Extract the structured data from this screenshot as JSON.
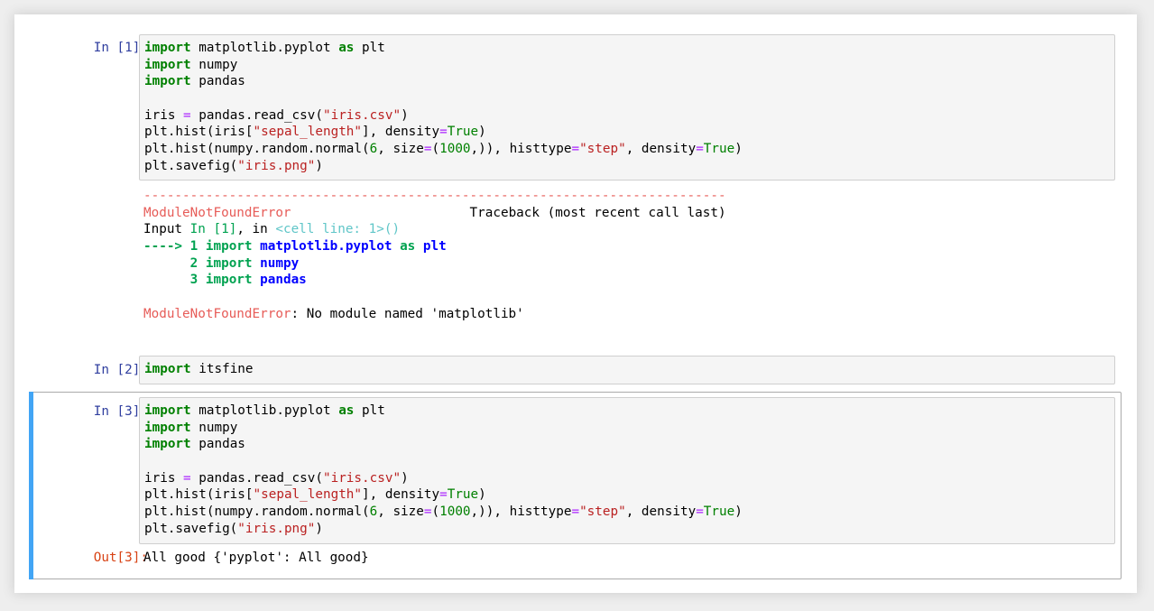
{
  "cell1": {
    "prompt": "In [1]:",
    "lines": [
      [
        {
          "t": "import",
          "c": "kw"
        },
        {
          "t": " matplotlib.pyplot ",
          "c": ""
        },
        {
          "t": "as",
          "c": "kw"
        },
        {
          "t": " plt",
          "c": ""
        }
      ],
      [
        {
          "t": "import",
          "c": "kw"
        },
        {
          "t": " numpy",
          "c": ""
        }
      ],
      [
        {
          "t": "import",
          "c": "kw"
        },
        {
          "t": " pandas",
          "c": ""
        }
      ],
      [],
      [
        {
          "t": "iris ",
          "c": ""
        },
        {
          "t": "=",
          "c": "op"
        },
        {
          "t": " pandas.read_csv(",
          "c": ""
        },
        {
          "t": "\"iris.csv\"",
          "c": "str"
        },
        {
          "t": ")",
          "c": ""
        }
      ],
      [
        {
          "t": "plt.hist(iris[",
          "c": ""
        },
        {
          "t": "\"sepal_length\"",
          "c": "str"
        },
        {
          "t": "], density",
          "c": ""
        },
        {
          "t": "=",
          "c": "op"
        },
        {
          "t": "True",
          "c": "kw-plain"
        },
        {
          "t": ")",
          "c": ""
        }
      ],
      [
        {
          "t": "plt.hist(numpy.random.normal(",
          "c": ""
        },
        {
          "t": "6",
          "c": "num"
        },
        {
          "t": ", size",
          "c": ""
        },
        {
          "t": "=",
          "c": "op"
        },
        {
          "t": "(",
          "c": ""
        },
        {
          "t": "1000",
          "c": "num"
        },
        {
          "t": ",)), histtype",
          "c": ""
        },
        {
          "t": "=",
          "c": "op"
        },
        {
          "t": "\"step\"",
          "c": "str"
        },
        {
          "t": ", density",
          "c": ""
        },
        {
          "t": "=",
          "c": "op"
        },
        {
          "t": "True",
          "c": "kw-plain"
        },
        {
          "t": ")",
          "c": ""
        }
      ],
      [
        {
          "t": "plt.savefig(",
          "c": ""
        },
        {
          "t": "\"iris.png\"",
          "c": "str"
        },
        {
          "t": ")",
          "c": ""
        }
      ]
    ],
    "error": {
      "dashes": "---------------------------------------------------------------------------",
      "header_name": "ModuleNotFoundError",
      "header_gap": "                       ",
      "header_traceback": "Traceback (most recent call last)",
      "input_line": [
        {
          "t": "Input ",
          "c": ""
        },
        {
          "t": "In [1]",
          "c": "ansi-green"
        },
        {
          "t": ", in ",
          "c": ""
        },
        {
          "t": "<cell line: 1>()",
          "c": "ansi-cyan"
        }
      ],
      "trace_lines": [
        [
          {
            "t": "----> 1 ",
            "c": "ansi-green-bold"
          },
          {
            "t": "import",
            "c": "ansi-green-bold"
          },
          {
            "t": " ",
            "c": ""
          },
          {
            "t": "matplotlib.pyplot",
            "c": "ansi-blue-bold"
          },
          {
            "t": " ",
            "c": ""
          },
          {
            "t": "as",
            "c": "ansi-green-bold"
          },
          {
            "t": " ",
            "c": ""
          },
          {
            "t": "plt",
            "c": "ansi-blue-bold"
          }
        ],
        [
          {
            "t": "      2 ",
            "c": "ansi-green-bold"
          },
          {
            "t": "import",
            "c": "ansi-green-bold"
          },
          {
            "t": " ",
            "c": ""
          },
          {
            "t": "numpy",
            "c": "ansi-blue-bold"
          }
        ],
        [
          {
            "t": "      3 ",
            "c": "ansi-green-bold"
          },
          {
            "t": "import",
            "c": "ansi-green-bold"
          },
          {
            "t": " ",
            "c": ""
          },
          {
            "t": "pandas",
            "c": "ansi-blue-bold"
          }
        ]
      ],
      "final_name": "ModuleNotFoundError",
      "final_message": ": No module named 'matplotlib'"
    }
  },
  "cell2": {
    "prompt": "In [2]:",
    "lines": [
      [
        {
          "t": "import",
          "c": "kw"
        },
        {
          "t": " itsfine",
          "c": ""
        }
      ]
    ]
  },
  "cell3": {
    "prompt": "In [3]:",
    "lines": [
      [
        {
          "t": "import",
          "c": "kw"
        },
        {
          "t": " matplotlib.pyplot ",
          "c": ""
        },
        {
          "t": "as",
          "c": "kw"
        },
        {
          "t": " plt",
          "c": ""
        }
      ],
      [
        {
          "t": "import",
          "c": "kw"
        },
        {
          "t": " numpy",
          "c": ""
        }
      ],
      [
        {
          "t": "import",
          "c": "kw"
        },
        {
          "t": " pandas",
          "c": ""
        }
      ],
      [],
      [
        {
          "t": "iris ",
          "c": ""
        },
        {
          "t": "=",
          "c": "op"
        },
        {
          "t": " pandas.read_csv(",
          "c": ""
        },
        {
          "t": "\"iris.csv\"",
          "c": "str"
        },
        {
          "t": ")",
          "c": ""
        }
      ],
      [
        {
          "t": "plt.hist(iris[",
          "c": ""
        },
        {
          "t": "\"sepal_length\"",
          "c": "str"
        },
        {
          "t": "], density",
          "c": ""
        },
        {
          "t": "=",
          "c": "op"
        },
        {
          "t": "True",
          "c": "kw-plain"
        },
        {
          "t": ")",
          "c": ""
        }
      ],
      [
        {
          "t": "plt.hist(numpy.random.normal(",
          "c": ""
        },
        {
          "t": "6",
          "c": "num"
        },
        {
          "t": ", size",
          "c": ""
        },
        {
          "t": "=",
          "c": "op"
        },
        {
          "t": "(",
          "c": ""
        },
        {
          "t": "1000",
          "c": "num"
        },
        {
          "t": ",)), histtype",
          "c": ""
        },
        {
          "t": "=",
          "c": "op"
        },
        {
          "t": "\"step\"",
          "c": "str"
        },
        {
          "t": ", density",
          "c": ""
        },
        {
          "t": "=",
          "c": "op"
        },
        {
          "t": "True",
          "c": "kw-plain"
        },
        {
          "t": ")",
          "c": ""
        }
      ],
      [
        {
          "t": "plt.savefig(",
          "c": ""
        },
        {
          "t": "\"iris.png\"",
          "c": "str"
        },
        {
          "t": ")",
          "c": ""
        }
      ]
    ],
    "out_prompt": "Out[3]:",
    "output": "All good {'pyplot': All good}"
  },
  "colors": {
    "in_prompt": "#303f9f",
    "out_prompt": "#d84315",
    "selected_bar": "#42a5f5",
    "keyword": "#008000",
    "string": "#ba2121",
    "operator": "#aa22ff",
    "error": "#e75c58"
  }
}
